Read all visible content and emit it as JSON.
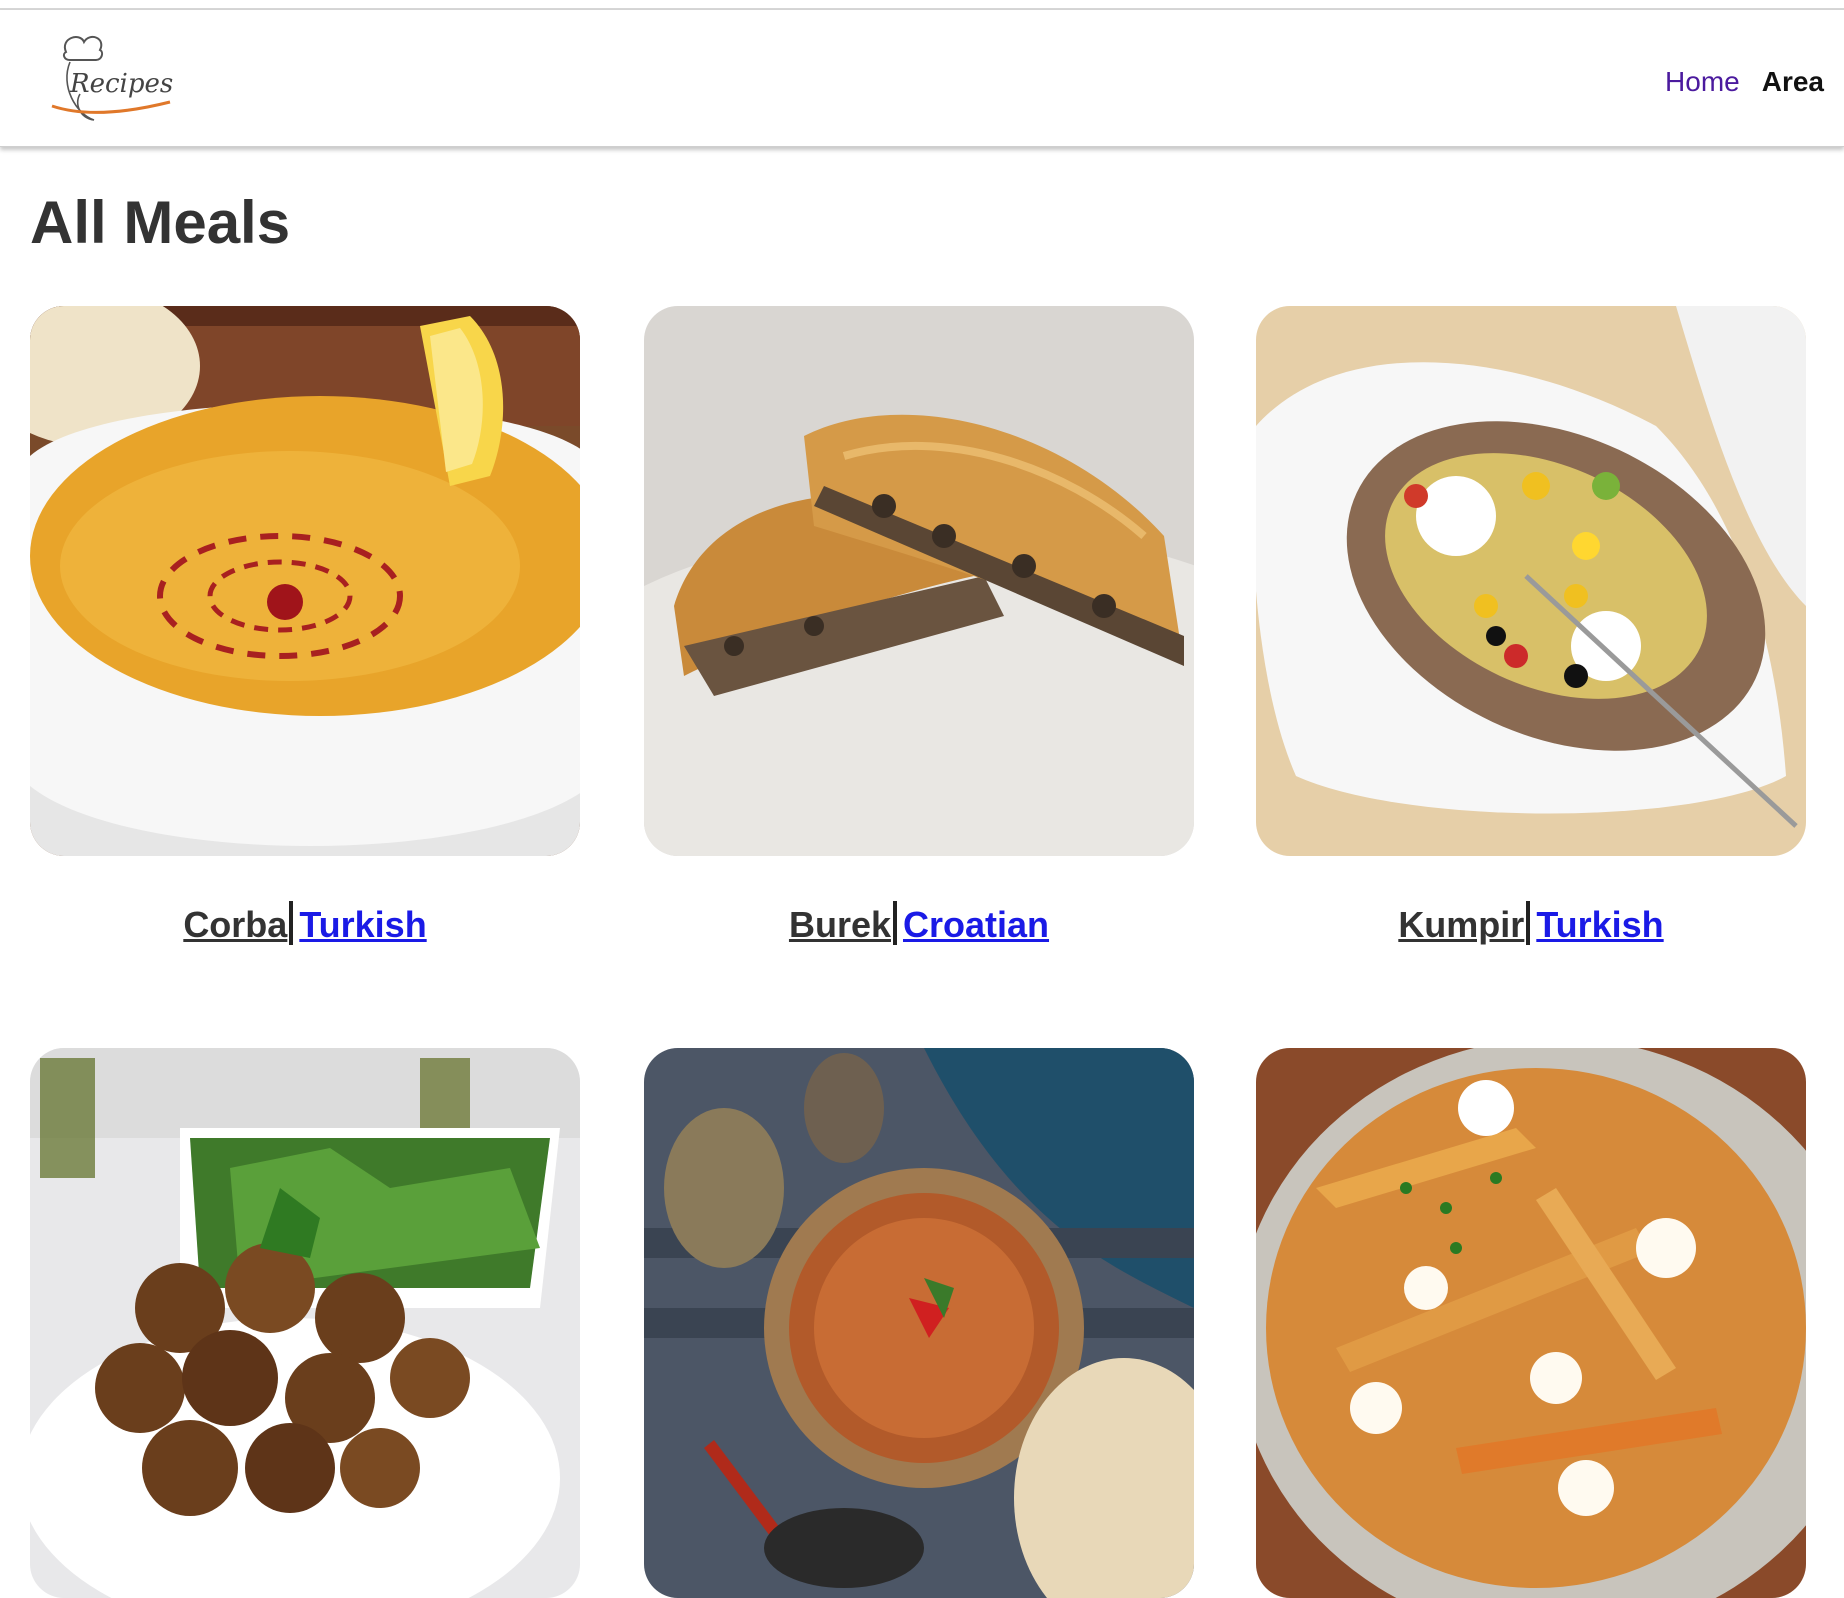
{
  "header": {
    "logo_text": "Recipes",
    "nav": {
      "home_label": "Home",
      "area_label": "Area"
    },
    "colors": {
      "home_link": "#4b1a9e",
      "area_link": "#111111"
    }
  },
  "main": {
    "title": "All Meals",
    "meals": [
      {
        "name": "Corba",
        "area": "Turkish",
        "image_icon": "lentil-soup-photo"
      },
      {
        "name": "Burek",
        "area": "Croatian",
        "image_icon": "burek-pastry-photo"
      },
      {
        "name": "Kumpir",
        "area": "Turkish",
        "image_icon": "stuffed-potato-photo"
      },
      {
        "image_icon": "falafel-plate-photo"
      },
      {
        "image_icon": "spiced-soup-bowl-photo"
      },
      {
        "image_icon": "poutine-fries-photo"
      }
    ]
  },
  "colors": {
    "area_link": "#1a1ae6",
    "meal_link": "#333333",
    "title": "#333333"
  }
}
